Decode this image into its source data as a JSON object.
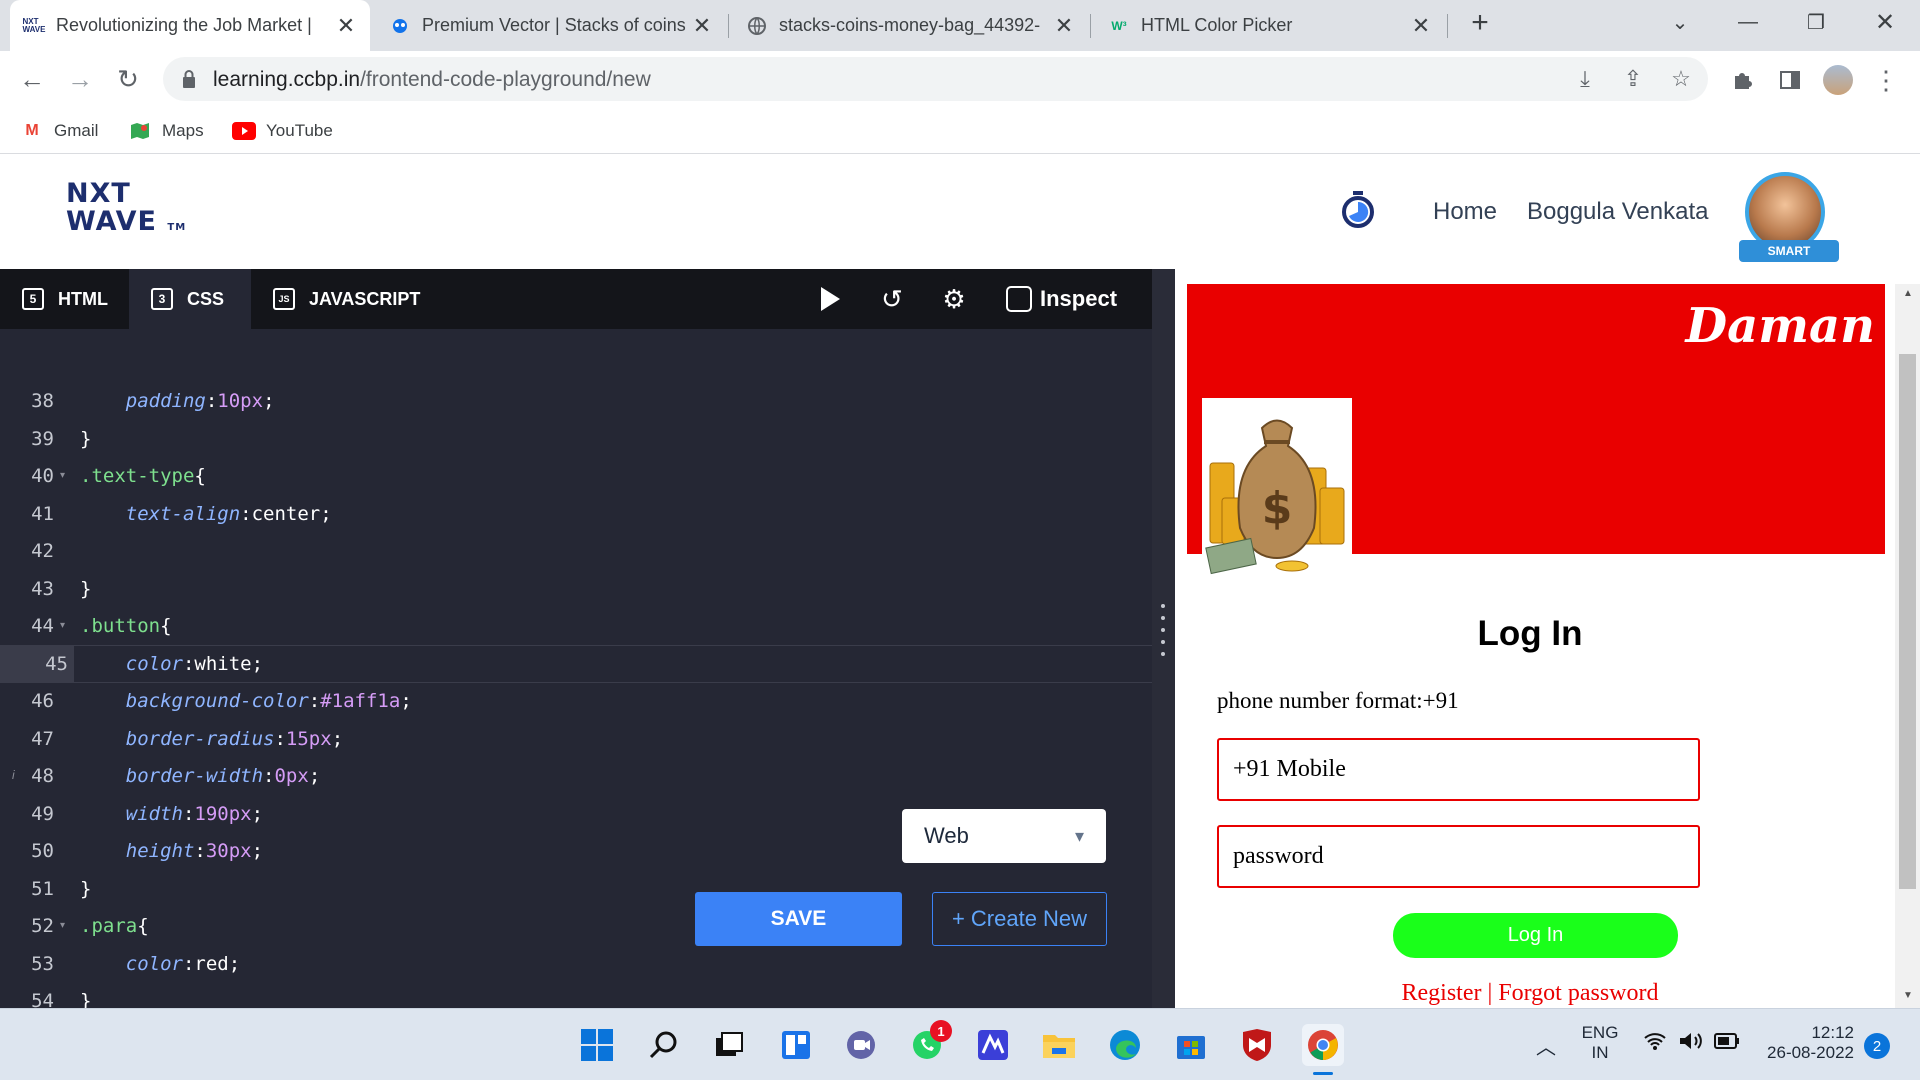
{
  "browser": {
    "tabs": [
      {
        "title": "Revolutionizing the Job Market |",
        "icon": "nxtwave-favicon",
        "active": true
      },
      {
        "title": "Premium Vector | Stacks of coins",
        "icon": "freepik-favicon",
        "active": false
      },
      {
        "title": "stacks-coins-money-bag_44392-",
        "icon": "globe-icon",
        "active": false
      },
      {
        "title": "HTML Color Picker",
        "icon": "w3schools-favicon",
        "active": false
      }
    ],
    "favicon_w3": "W³",
    "url_host": "learning.ccbp.in",
    "url_path": "/frontend-code-playground/new",
    "bookmarks": [
      {
        "label": "Gmail",
        "icon": "gmail-icon"
      },
      {
        "label": "Maps",
        "icon": "maps-icon"
      },
      {
        "label": "YouTube",
        "icon": "youtube-icon"
      }
    ]
  },
  "site": {
    "logo_line1": "NXT",
    "logo_line2": "WAVE",
    "logo_tm": "TM",
    "nav_home": "Home",
    "user_name": "Boggula Venkata",
    "avatar_badge": "SMART"
  },
  "editor": {
    "tabs": [
      {
        "label": "HTML",
        "icon": "html5-icon"
      },
      {
        "label": "CSS",
        "icon": "css3-icon"
      },
      {
        "label": "JAVASCRIPT",
        "icon": "js-file-icon"
      }
    ],
    "inspect_label": "Inspect",
    "lines": [
      {
        "n": "38",
        "fold": false,
        "tokens": [
          [
            "prop",
            "    padding"
          ],
          [
            "punc",
            ":"
          ],
          [
            "num",
            "10px"
          ],
          [
            "punc",
            ";"
          ]
        ]
      },
      {
        "n": "39",
        "fold": false,
        "tokens": [
          [
            "punc",
            "}"
          ]
        ]
      },
      {
        "n": "40",
        "fold": true,
        "tokens": [
          [
            "sel",
            ".text-type"
          ],
          [
            "punc",
            "{"
          ]
        ]
      },
      {
        "n": "41",
        "fold": false,
        "tokens": [
          [
            "prop",
            "    text-align"
          ],
          [
            "punc",
            ":"
          ],
          [
            "val",
            "center"
          ],
          [
            "punc",
            ";"
          ]
        ]
      },
      {
        "n": "42",
        "fold": false,
        "tokens": []
      },
      {
        "n": "43",
        "fold": false,
        "tokens": [
          [
            "punc",
            "}"
          ]
        ]
      },
      {
        "n": "44",
        "fold": true,
        "tokens": [
          [
            "sel",
            ".button"
          ],
          [
            "punc",
            "{"
          ]
        ]
      },
      {
        "n": "45",
        "fold": false,
        "tokens": [
          [
            "prop",
            "    color"
          ],
          [
            "punc",
            ":"
          ],
          [
            "val",
            "white"
          ],
          [
            "punc",
            ";"
          ]
        ]
      },
      {
        "n": "46",
        "fold": false,
        "tokens": [
          [
            "prop",
            "    background-color"
          ],
          [
            "punc",
            ":"
          ],
          [
            "num",
            "#1aff1a"
          ],
          [
            "punc",
            ";"
          ]
        ]
      },
      {
        "n": "47",
        "fold": false,
        "tokens": [
          [
            "prop",
            "    border-radius"
          ],
          [
            "punc",
            ":"
          ],
          [
            "num",
            "15px"
          ],
          [
            "punc",
            ";"
          ]
        ]
      },
      {
        "n": "48",
        "fold": false,
        "tokens": [
          [
            "prop",
            "    border-width"
          ],
          [
            "punc",
            ":"
          ],
          [
            "num",
            "0px"
          ],
          [
            "punc",
            ";"
          ]
        ]
      },
      {
        "n": "49",
        "fold": false,
        "tokens": [
          [
            "prop",
            "    width"
          ],
          [
            "punc",
            ":"
          ],
          [
            "num",
            "190px"
          ],
          [
            "punc",
            ";"
          ]
        ]
      },
      {
        "n": "50",
        "fold": false,
        "tokens": [
          [
            "prop",
            "    height"
          ],
          [
            "punc",
            ":"
          ],
          [
            "num",
            "30px"
          ],
          [
            "punc",
            ";"
          ]
        ]
      },
      {
        "n": "51",
        "fold": false,
        "tokens": [
          [
            "punc",
            "}"
          ]
        ]
      },
      {
        "n": "52",
        "fold": true,
        "tokens": [
          [
            "sel",
            ".para"
          ],
          [
            "punc",
            "{"
          ]
        ]
      },
      {
        "n": "53",
        "fold": false,
        "tokens": [
          [
            "prop",
            "    color"
          ],
          [
            "punc",
            ":"
          ],
          [
            "val",
            "red"
          ],
          [
            "punc",
            ";"
          ]
        ]
      },
      {
        "n": "54",
        "fold": false,
        "tokens": [
          [
            "punc",
            "}"
          ]
        ]
      }
    ],
    "current_line": "45",
    "view_select": "Web",
    "save_label": "SAVE",
    "create_label": "+ Create New"
  },
  "preview": {
    "brand": "Daman",
    "login_title": "Log In",
    "phone_format": "phone number format:+91",
    "mobile_value": "+91 Mobile",
    "password_value": "password",
    "login_button": "Log In",
    "links": "Register | Forgot password",
    "colors": {
      "banner": "#e90000",
      "button": "#1aff1a"
    }
  },
  "taskbar": {
    "whatsapp_badge": "1",
    "lang_top": "ENG",
    "lang_bottom": "IN",
    "time": "12:12",
    "date": "26-08-2022",
    "notif_count": "2"
  }
}
